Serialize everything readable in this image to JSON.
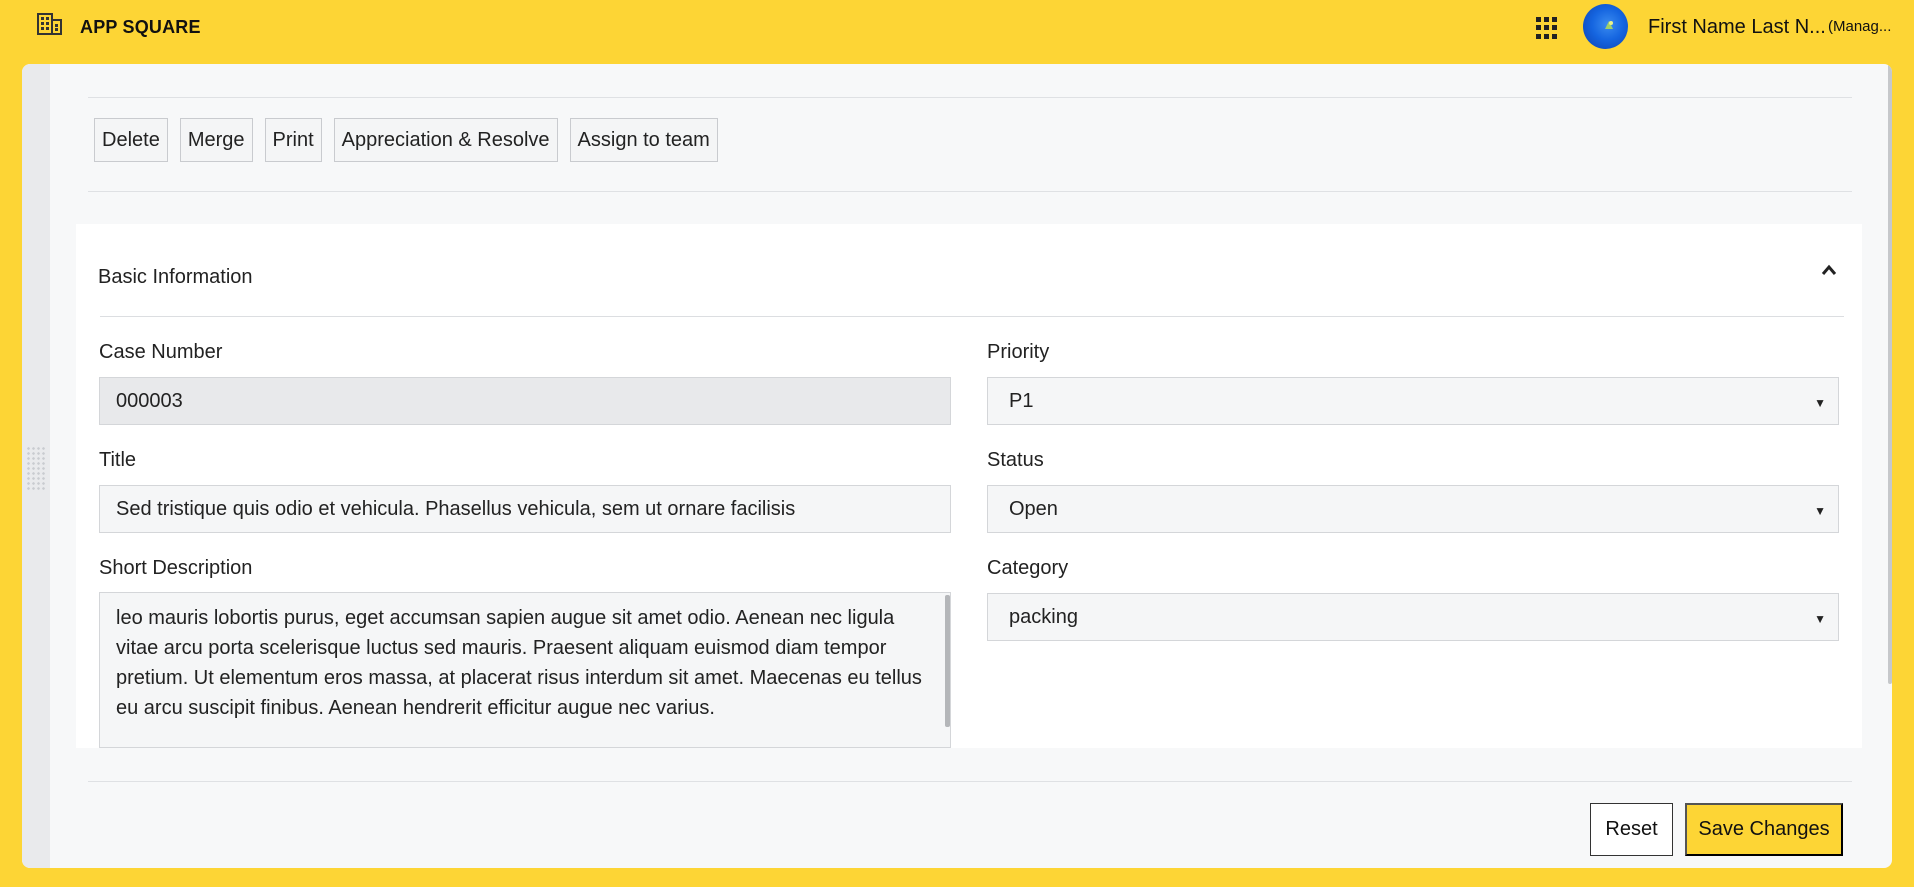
{
  "app": {
    "title": "APP SQUARE",
    "brand_icon": "building-icon"
  },
  "header": {
    "apps_icon": "grid-icon",
    "user_name": "First Name Last N...",
    "user_role": "(Manag..."
  },
  "toolbar": {
    "delete_label": "Delete",
    "merge_label": "Merge",
    "print_label": "Print",
    "appreciation_label": "Appreciation & Resolve",
    "assign_label": "Assign to team"
  },
  "section": {
    "title": "Basic Information",
    "collapse_icon": "chevron-up-icon"
  },
  "form": {
    "case_number": {
      "label": "Case Number",
      "value": "000003"
    },
    "title": {
      "label": "Title",
      "value": "Sed tristique quis odio et vehicula. Phasellus vehicula, sem ut ornare facilisis"
    },
    "short_description": {
      "label": "Short Description",
      "value": "leo mauris lobortis purus, eget accumsan sapien augue sit amet odio. Aenean nec ligula vitae arcu porta scelerisque luctus sed mauris. Praesent aliquam euismod diam tempor pretium. Ut elementum eros massa, at placerat risus interdum sit amet. Maecenas eu tellus eu arcu suscipit finibus. Aenean hendrerit efficitur augue nec varius."
    },
    "priority": {
      "label": "Priority",
      "value": "P1"
    },
    "status": {
      "label": "Status",
      "value": "Open"
    },
    "category": {
      "label": "Category",
      "value": "packing"
    }
  },
  "footer": {
    "reset_label": "Reset",
    "save_label": "Save Changes"
  },
  "colors": {
    "accent": "#fdd535",
    "surface": "#f7f8f9",
    "card": "#ffffff"
  }
}
